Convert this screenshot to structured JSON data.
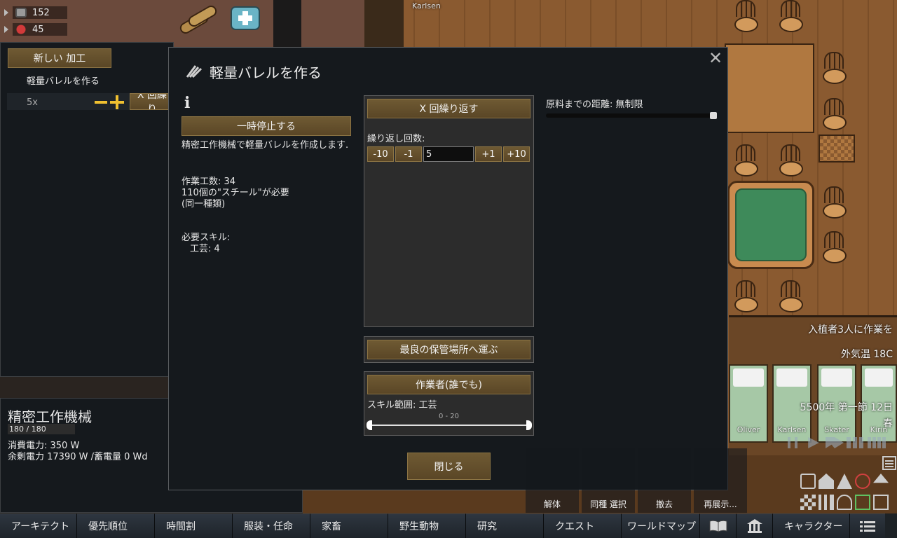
{
  "resources": [
    {
      "icon": "steel-icon",
      "count": "152"
    },
    {
      "icon": "berries-icon",
      "count": "45"
    }
  ],
  "world": {
    "karlsen_top": "Karlsen",
    "colonists": [
      "Oliver",
      "Karlsen",
      "Skater",
      "Kirin"
    ],
    "hud": {
      "work_alert": "入植者3人に作業を",
      "temperature": "外気温 18C",
      "date": "5500年 第一節 12日",
      "season": "春"
    }
  },
  "bills_panel": {
    "new_bill_button": "新しい 加工",
    "bill_name": "軽量バレルを作る",
    "bill_count": "5x",
    "repeat_button_partial": "X 回繰り"
  },
  "inspect": {
    "title": "精密工作機械",
    "hp": "180 / 180",
    "power_use": "消費電力: 350 W",
    "power_surplus": "余剰電力 17390 W /蓄電量 0 Wd"
  },
  "dialog": {
    "title": "軽量バレルを作る",
    "info_icon": "i",
    "suspend_button": "一時停止する",
    "description": "精密工作機械で軽量バレルを作成します.",
    "work_amount": "作業工数: 34",
    "ingredients": "110個の\"スチール\"が必要",
    "ingredients_note": "(同一種類)",
    "skills_header": "必要スキル:",
    "skill_line": "工芸: 4",
    "repeat_mode_button": "X 回繰り返す",
    "repeat_count_label": "繰り返し回数:",
    "btn_minus10": "-10",
    "btn_minus1": "-1",
    "count_value": "5",
    "btn_plus1": "+1",
    "btn_plus10": "+10",
    "store_mode_button": "最良の保管場所へ運ぶ",
    "worker_button": "作業者(誰でも)",
    "skill_range_label": "スキル範囲: 工芸",
    "skill_range_value": "0 - 20",
    "ingredient_radius_label": "原料までの距離: 無制限",
    "ingredient_radius_fraction": 1.0,
    "close_button": "閉じる"
  },
  "orders": [
    "解体",
    "同種 選択",
    "撤去",
    "再展示..."
  ],
  "bottom_tabs": [
    {
      "label": "アーキテクト"
    },
    {
      "label": "優先順位"
    },
    {
      "label": "時間割"
    },
    {
      "label": "服装・任命"
    },
    {
      "label": "家畜"
    },
    {
      "label": "野生動物"
    },
    {
      "label": "研究"
    },
    {
      "label": "クエスト"
    },
    {
      "label": "ワールドマップ"
    },
    {
      "label": "",
      "icon": "book-icon"
    },
    {
      "label": "",
      "icon": "factions-icon"
    },
    {
      "label": "キャラクター"
    },
    {
      "label": "",
      "icon": "menu-icon"
    }
  ]
}
